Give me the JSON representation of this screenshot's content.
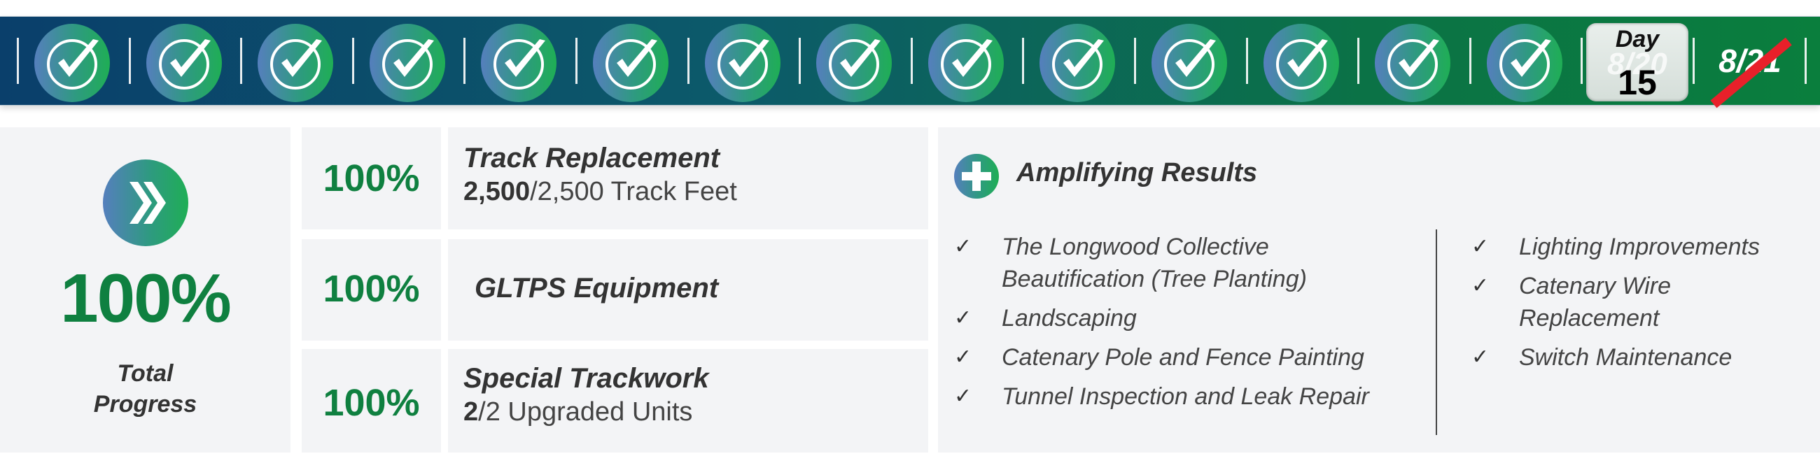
{
  "banner": {
    "completed_days": 14,
    "current_day": {
      "label": "Day",
      "date": "8/20",
      "number": "15"
    },
    "next_date": "8/21",
    "colors": {
      "start": "#0a3f6b",
      "end": "#0a7e3d",
      "slash": "#e8202a"
    }
  },
  "total": {
    "percent": "100%",
    "label_line1": "Total",
    "label_line2": "Progress",
    "icon": "double-chevron-right-icon"
  },
  "tasks": [
    {
      "percent": "100%",
      "title": "Track Replacement",
      "done": "2,500",
      "detail": "/2,500 Track Feet"
    },
    {
      "percent": "100%",
      "title": "GLTPS Equipment",
      "done": "",
      "detail": ""
    },
    {
      "percent": "100%",
      "title": "Special Trackwork",
      "done": "2",
      "detail": "/2 Upgraded Units"
    }
  ],
  "amplifying": {
    "title": "Amplifying Results",
    "icon": "plus-icon",
    "check_glyph": "✓",
    "column1": [
      "The Longwood Collective Beautification (Tree Planting)",
      "Landscaping",
      "Catenary Pole and Fence Painting",
      "Tunnel Inspection and Leak Repair"
    ],
    "column2": [
      "Lighting Improvements",
      "Catenary Wire Replacement",
      "Switch Maintenance"
    ]
  },
  "colors": {
    "accent_green": "#0f8040",
    "panel_bg": "#f3f4f6"
  }
}
